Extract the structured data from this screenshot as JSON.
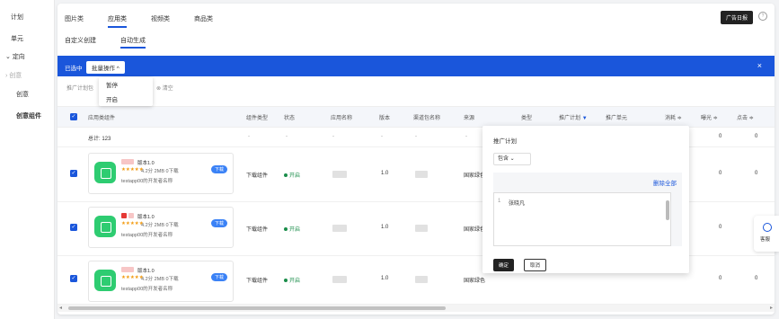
{
  "sidebar": {
    "items": [
      {
        "label": "计划",
        "state": "normal"
      },
      {
        "label": "单元",
        "state": "normal"
      },
      {
        "label": "定向",
        "state": "normal"
      },
      {
        "label": "创意",
        "state": "muted"
      },
      {
        "label": "创意",
        "state": "normal"
      },
      {
        "label": "创意组件",
        "state": "active"
      }
    ]
  },
  "tabs": [
    "图片类",
    "应用类",
    "视频类",
    "商品类"
  ],
  "active_tab": "应用类",
  "subtabs": [
    "自定义创建",
    "自动生成"
  ],
  "active_subtab": "自动生成",
  "top_button": "广告日报",
  "help_icon": "?",
  "bulk_bar": {
    "selected_text": "已选中",
    "batch_label": "批量操作 ^",
    "close": "×",
    "color": "#1a56db"
  },
  "dropdown": {
    "items": [
      "暂停",
      "开启"
    ]
  },
  "filter": {
    "prefix": "推广计划包",
    "clear": "清空"
  },
  "columns": [
    "应用类组件",
    "组件类型",
    "状态",
    "应用名称",
    "版本",
    "渠道包名称",
    "来源",
    "类型",
    "推广计划",
    "推广单元",
    "消耗 ≑",
    "曝光 ≑",
    "点击 ≑"
  ],
  "total_label": "总计: 123",
  "total_values": [
    "-",
    "-",
    "-",
    "-",
    "-",
    "-",
    "0",
    "0"
  ],
  "rows": [
    {
      "card": {
        "name": "版本1.0",
        "stars": "★★★★★",
        "stats": "4.2分 2MB 0下载",
        "dev": "testapp00的开发者名称",
        "download": "下载"
      },
      "type": "下载组件",
      "status": "开启",
      "version": "1.0",
      "source": "国家绿色",
      "cost": "0",
      "impr": "0"
    },
    {
      "card": {
        "name": "版本1.0",
        "stars": "★★★★★",
        "stats": "4.2分 2MB 0下载",
        "dev": "testapp00的开发者名称",
        "download": "下载"
      },
      "type": "下载组件",
      "status": "开启",
      "version": "1.0",
      "source": "国家绿色",
      "cost": "0",
      "impr": "0"
    },
    {
      "card": {
        "name": "版本1.0",
        "stars": "★★★★★",
        "stats": "4.2分 2MB 0下载",
        "dev": "testapp00的开发者名称",
        "download": "下载"
      },
      "type": "下载组件",
      "status": "开启",
      "version": "1.0",
      "source": "国家绿色",
      "cost": "0",
      "impr": "0"
    }
  ],
  "filter_panel": {
    "title": "推广计划",
    "operator": "包含 ⌄",
    "clear_all": "删除全部",
    "line_no": "1",
    "value": "张晓凡",
    "confirm": "确定",
    "cancel": "取消"
  },
  "float_widget": {
    "label": "客服"
  },
  "scrollbar": {
    "left": "◂",
    "right": "▸"
  }
}
